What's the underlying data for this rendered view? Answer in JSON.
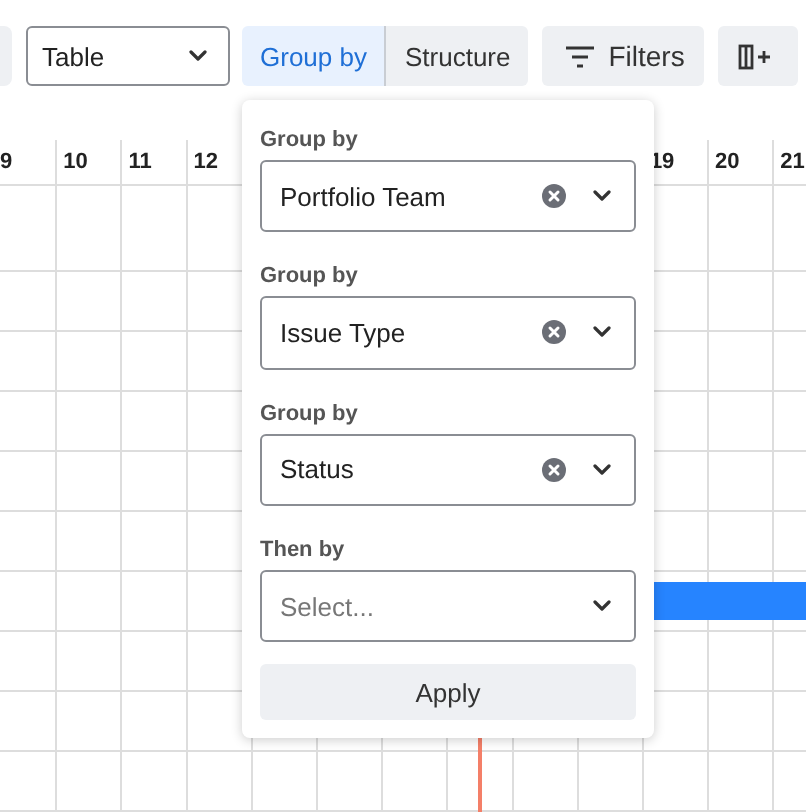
{
  "toolbar": {
    "view_select": {
      "value": "Table"
    },
    "segments": [
      {
        "label": "Group by",
        "selected": true
      },
      {
        "label": "Structure",
        "selected": false
      }
    ],
    "filters_button": {
      "label": "Filters"
    }
  },
  "timeline": {
    "days_before_popup": [
      "9",
      "10",
      "11",
      "12"
    ],
    "days_after_popup": [
      "19",
      "20",
      "21"
    ]
  },
  "group_popup": {
    "fields": [
      {
        "label": "Group by",
        "value": "Portfolio Team"
      },
      {
        "label": "Group by",
        "value": "Issue Type"
      },
      {
        "label": "Group by",
        "value": "Status"
      },
      {
        "label": "Then by",
        "placeholder": "Select..."
      }
    ],
    "apply_button": "Apply"
  }
}
